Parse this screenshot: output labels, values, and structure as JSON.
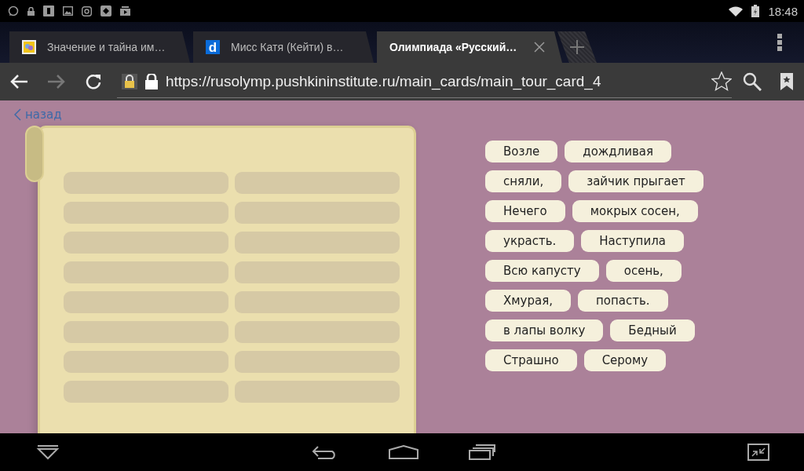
{
  "status_bar": {
    "time": "18:48"
  },
  "tabs": [
    {
      "title": "Значение и тайна им…",
      "selected": false,
      "kind": "picture"
    },
    {
      "title": "Мисс Катя (Кейти) в…",
      "selected": false,
      "kind": "letter",
      "favicon_letter": "d"
    },
    {
      "title": "Олимпиада «Русский…",
      "selected": true,
      "kind": "plain"
    }
  ],
  "address_bar": {
    "url": "https://rusolymp.pushkininstitute.ru/main_cards/main_tour_card_4"
  },
  "page": {
    "back_link": "назад",
    "word_rows": [
      [
        "Возле",
        "дождливая"
      ],
      [
        "сняли,",
        "зайчик прыгает"
      ],
      [
        "Нечего",
        "мокрых сосен,"
      ],
      [
        "украсть.",
        "Наступила"
      ],
      [
        "Всю капусту",
        "осень,"
      ],
      [
        "Хмурая,",
        "попасть."
      ],
      [
        "в лапы волку",
        "Бедный"
      ],
      [
        "Страшно",
        "Серому"
      ]
    ]
  }
}
